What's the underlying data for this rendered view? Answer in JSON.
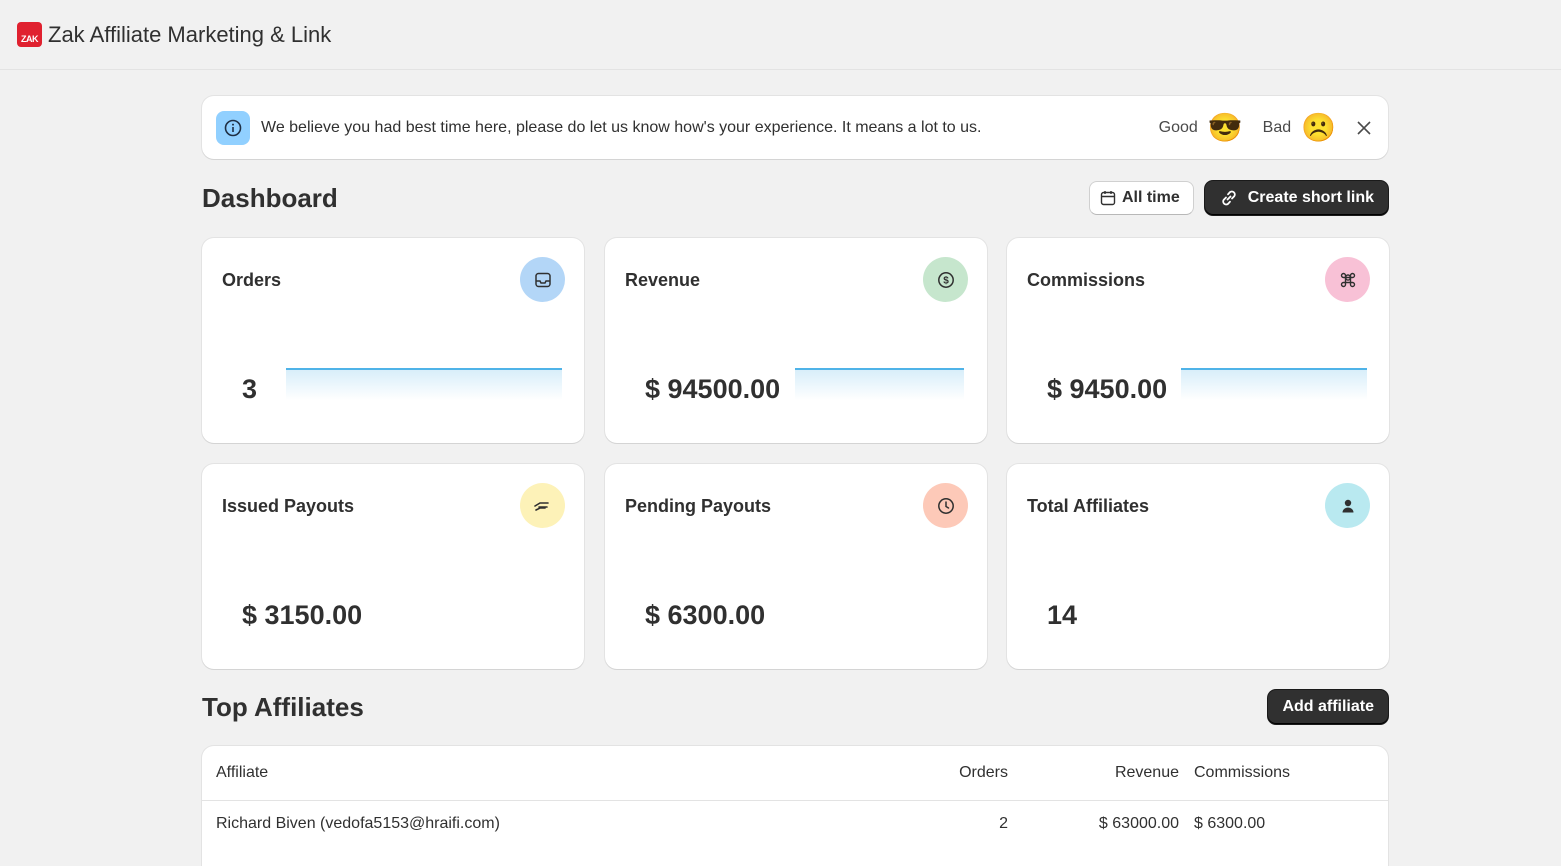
{
  "app": {
    "logo_text": "ZAK",
    "title": "Zak Affiliate Marketing & Link"
  },
  "banner": {
    "icon": "info-icon",
    "text": "We believe you had best time here, please do let us know how's your experience. It means a lot to us.",
    "good_label": "Good",
    "good_emoji": "😎",
    "bad_label": "Bad",
    "bad_emoji": "☹️"
  },
  "dashboard": {
    "title": "Dashboard",
    "date_filter_label": "All time",
    "create_link_label": "Create short link"
  },
  "cards": [
    {
      "title": "Orders",
      "value": "3",
      "icon": "inbox-icon",
      "icon_bg": "#b3d6f7",
      "spark": true
    },
    {
      "title": "Revenue",
      "value": "$ 94500.00",
      "icon": "dollar-circle-icon",
      "icon_bg": "#c6e6cd",
      "spark": true
    },
    {
      "title": "Commissions",
      "value": "$ 9450.00",
      "icon": "command-icon",
      "icon_bg": "#f8c1d6",
      "spark": true
    },
    {
      "title": "Issued Payouts",
      "value": "$ 3150.00",
      "icon": "hand-cash-icon",
      "icon_bg": "#fdf2b8",
      "spark": false
    },
    {
      "title": "Pending Payouts",
      "value": "$ 6300.00",
      "icon": "clock-icon",
      "icon_bg": "#fdc9b8",
      "spark": false
    },
    {
      "title": "Total Affiliates",
      "value": "14",
      "icon": "person-icon",
      "icon_bg": "#b9e9f0",
      "spark": false
    }
  ],
  "top_affiliates": {
    "title": "Top Affiliates",
    "add_label": "Add affiliate",
    "columns": {
      "affiliate": "Affiliate",
      "orders": "Orders",
      "revenue": "Revenue",
      "commissions": "Commissions"
    },
    "rows": [
      {
        "affiliate": "Richard Biven (vedofa5153@hraifi.com)",
        "orders": "2",
        "revenue": "$ 63000.00",
        "commissions": "$ 6300.00"
      }
    ]
  }
}
